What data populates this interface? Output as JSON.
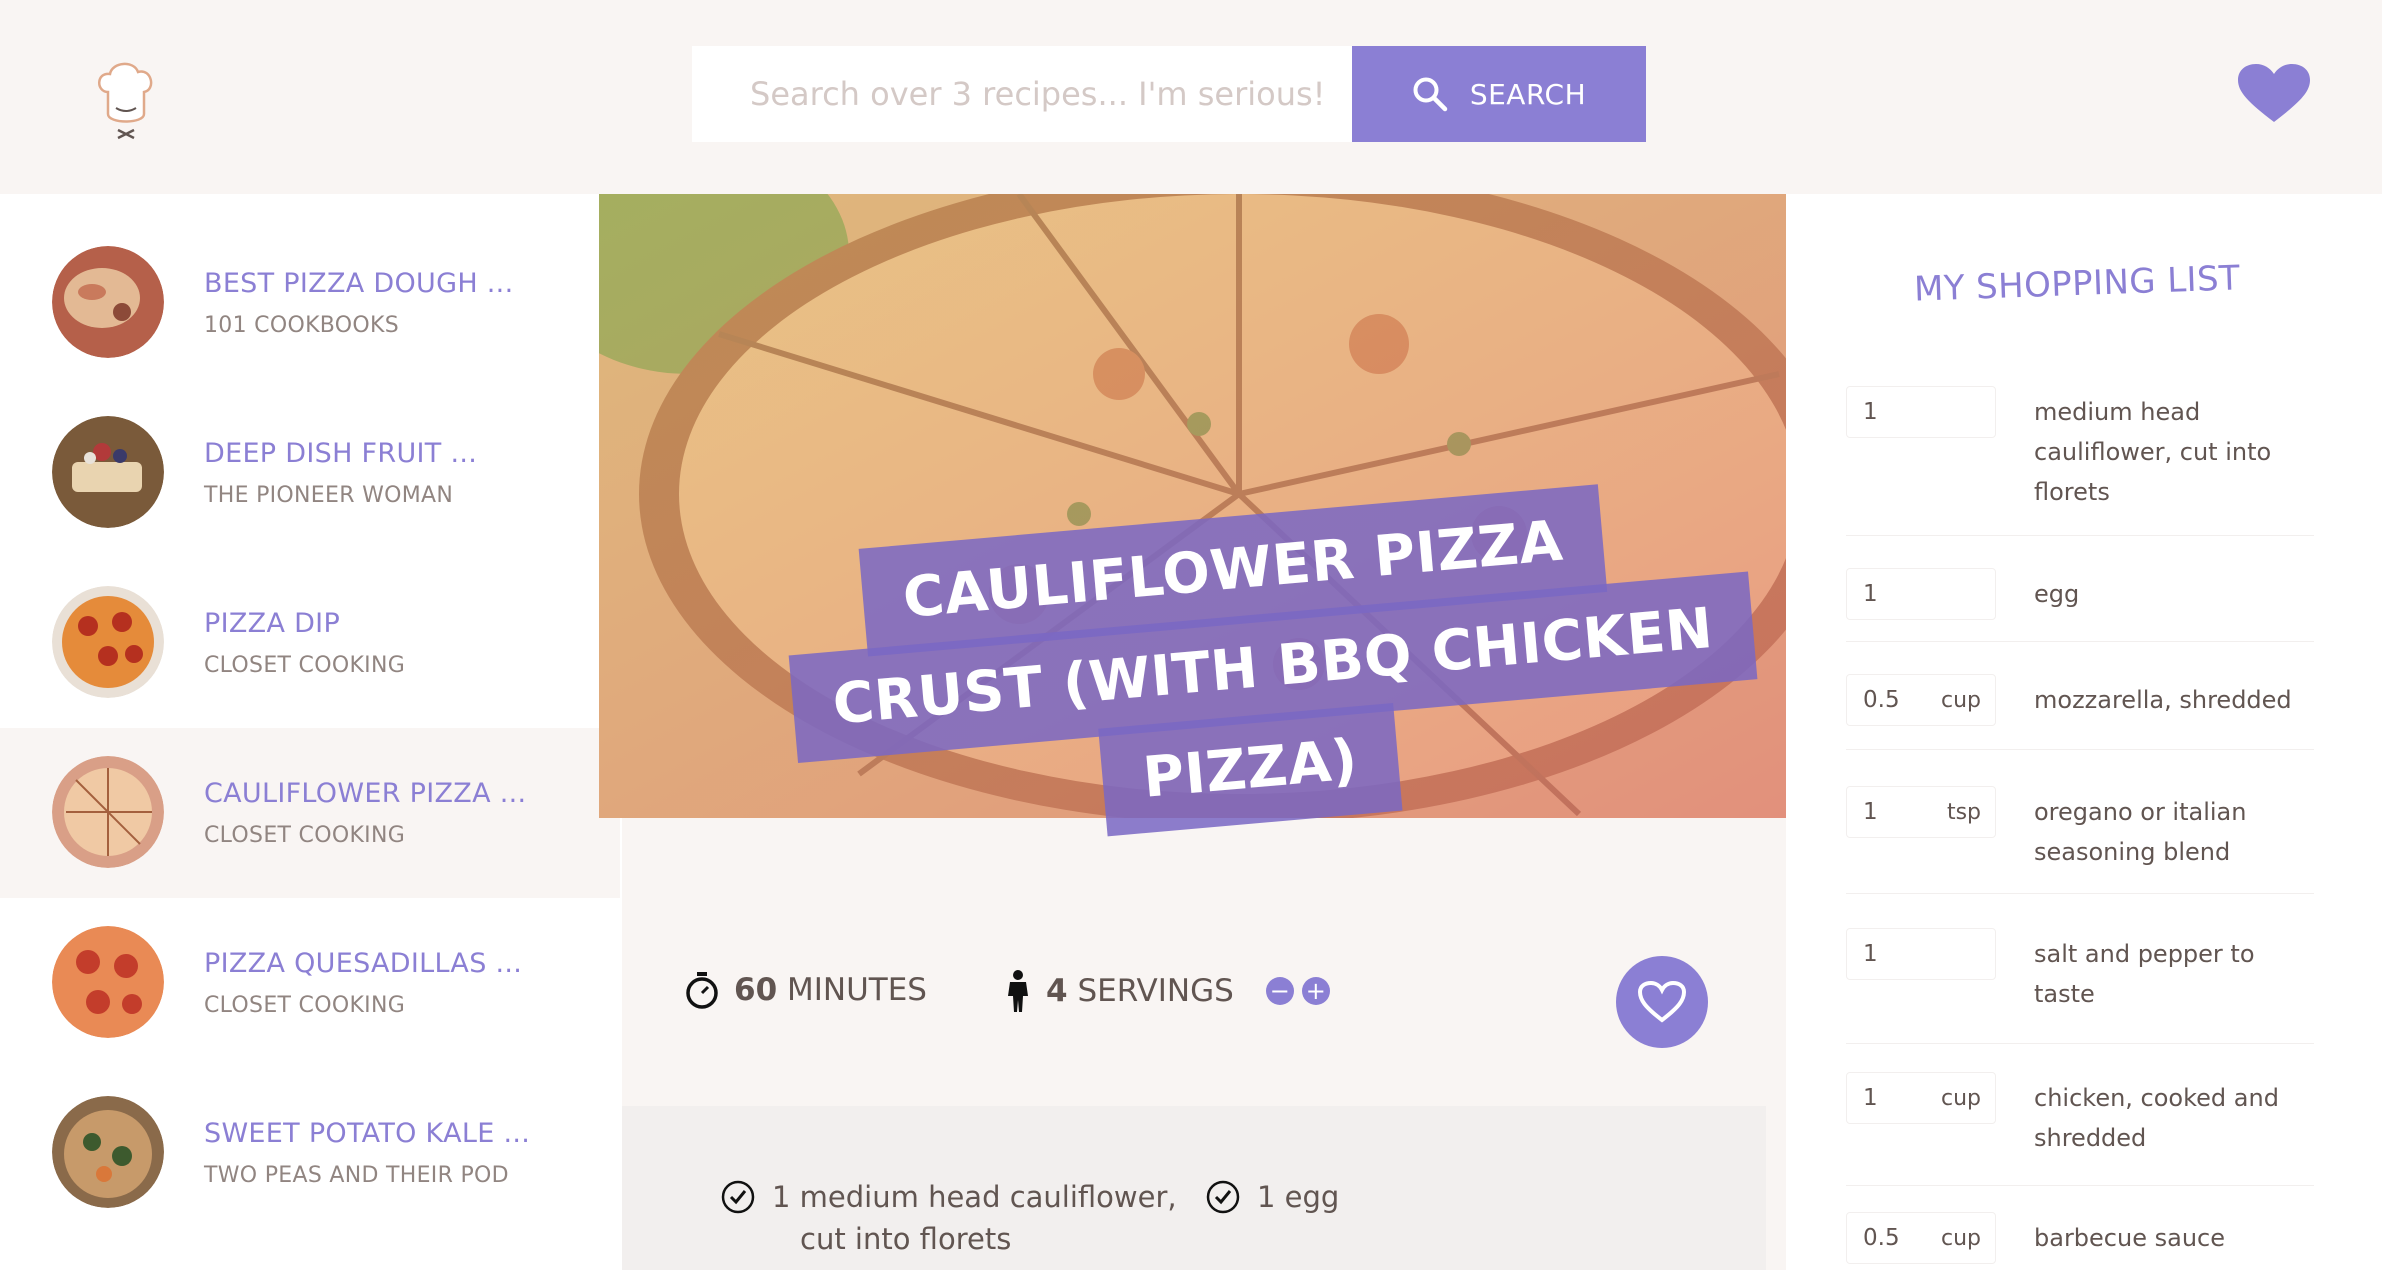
{
  "search": {
    "placeholder": "Search over 3 recipes... I'm serious!",
    "button_label": "SEARCH"
  },
  "colors": {
    "accent": "#8b7fd4",
    "background": "#f9f5f3",
    "text": "#615551"
  },
  "results": [
    {
      "title": "BEST PIZZA DOUGH ...",
      "author": "101 COOKBOOKS"
    },
    {
      "title": "DEEP DISH FRUIT ...",
      "author": "THE PIONEER WOMAN"
    },
    {
      "title": "PIZZA DIP",
      "author": "CLOSET COOKING"
    },
    {
      "title": "CAULIFLOWER PIZZA ...",
      "author": "CLOSET COOKING"
    },
    {
      "title": "PIZZA QUESADILLAS ...",
      "author": "CLOSET COOKING"
    },
    {
      "title": "SWEET POTATO KALE ...",
      "author": "TWO PEAS AND THEIR POD"
    }
  ],
  "recipe": {
    "title_lines": [
      "CAULIFLOWER PIZZA",
      "CRUST (WITH BBQ CHICKEN",
      "PIZZA)"
    ],
    "minutes": "60",
    "minutes_label": "MINUTES",
    "servings": "4",
    "servings_label": "SERVINGS",
    "ingredients": [
      {
        "count": "1",
        "line1": "medium head cauliflower,",
        "line2": "cut into florets"
      },
      {
        "count": "1",
        "line1": "egg",
        "line2": ""
      }
    ]
  },
  "shopping_list": {
    "title": "MY SHOPPING LIST",
    "items": [
      {
        "qty": "1",
        "unit": "",
        "desc": "medium head cauliflower, cut into florets"
      },
      {
        "qty": "1",
        "unit": "",
        "desc": "egg"
      },
      {
        "qty": "0.5",
        "unit": "cup",
        "desc": "mozzarella, shredded"
      },
      {
        "qty": "1",
        "unit": "tsp",
        "desc": "oregano or italian seasoning blend"
      },
      {
        "qty": "1",
        "unit": "",
        "desc": "salt and pepper to taste"
      },
      {
        "qty": "1",
        "unit": "cup",
        "desc": "chicken, cooked and shredded"
      },
      {
        "qty": "0.5",
        "unit": "cup",
        "desc": "barbecue sauce"
      }
    ]
  }
}
